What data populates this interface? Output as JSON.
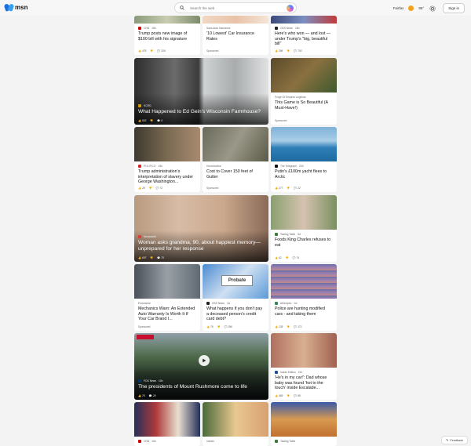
{
  "header": {
    "logo_text": "msn",
    "search_placeholder": "Search the web",
    "location": "Fairfax",
    "temperature": "85°",
    "signin": "Sign in"
  },
  "cards": {
    "c1": {
      "source": "CNN",
      "age": "18h",
      "title": "Trump posts new image of $100 bill with his signature",
      "likes": "479",
      "comments": "209"
    },
    "c2": {
      "source": "Sava Auto Insurance",
      "title": "'10 Lowest' Car Insurance Rates",
      "sponsored": "Sponsored"
    },
    "c3": {
      "source": "CBS News",
      "age": "18h",
      "title": "Here's who won — and lost — under Trump's \"big, beautiful bill\"",
      "likes": "396",
      "comments": "793"
    },
    "c4": {
      "source": "KCRG",
      "title": "What Happened to Ed Gein's Wisconsin Farmhouse?",
      "likes": "933",
      "comments": "6"
    },
    "c5": {
      "source": "Forge Of Empires Legends",
      "title": "This Game is So Beautiful (A Must-Have!)",
      "sponsored": "Sponsored"
    },
    "c6": {
      "source": "POLITICO",
      "age": "15h",
      "title": "Trump administration's interpretation of slavery under George Washington...",
      "likes": "28",
      "comments": "72"
    },
    "c7": {
      "source": "HomeAdvise",
      "title": "Cost to Cover 150 feet of Gutter",
      "sponsored": "Sponsored"
    },
    "c8": {
      "source": "The Telegraph",
      "age": "20h",
      "title": "Putin's £100m yacht flees to Arctic",
      "likes": "277",
      "comments": "22"
    },
    "c9": {
      "source": "Newsweek",
      "title": "Woman asks grandma, 90, about happiest memory—unprepared for her response",
      "likes": "697",
      "comments": "75"
    },
    "c10": {
      "source": "Tasting Table",
      "age": "5d",
      "title": "Foods King Charles refuses to eat",
      "likes": "62",
      "comments": "74"
    },
    "c11": {
      "source": "Endurance",
      "title": "Mechanics Warn: An Extended Auto Warranty Is Worth It If Your Car Brand I...",
      "sponsored": "Sponsored"
    },
    "c12": {
      "source": "CBS News",
      "age": "1w",
      "title": "What happens if you don't pay a deceased person's credit card debt?",
      "likes": "76",
      "comments": "396",
      "probate": "Probate"
    },
    "c13": {
      "source": "Allrecipes",
      "age": "1w",
      "title": "Police are hunting modified cars - and taking them",
      "likes": "138",
      "comments": "171"
    },
    "c14": {
      "source": "FOX News",
      "age": "10h",
      "title": "The presidents of Mount Rushmore come to life",
      "likes": "7K",
      "comments": "29"
    },
    "c15": {
      "source": "Inside Edition",
      "age": "21h",
      "title": "'He's in my car!': Dad whose baby was found 'hot to the touch' inside Escalade...",
      "likes": "469",
      "comments": "88"
    },
    "c16": {
      "source": "CNN",
      "age": "16h"
    },
    "c17": {
      "source": "Insider"
    },
    "c18": {
      "source": "Tasting Table"
    }
  },
  "feedback": "Feedback"
}
